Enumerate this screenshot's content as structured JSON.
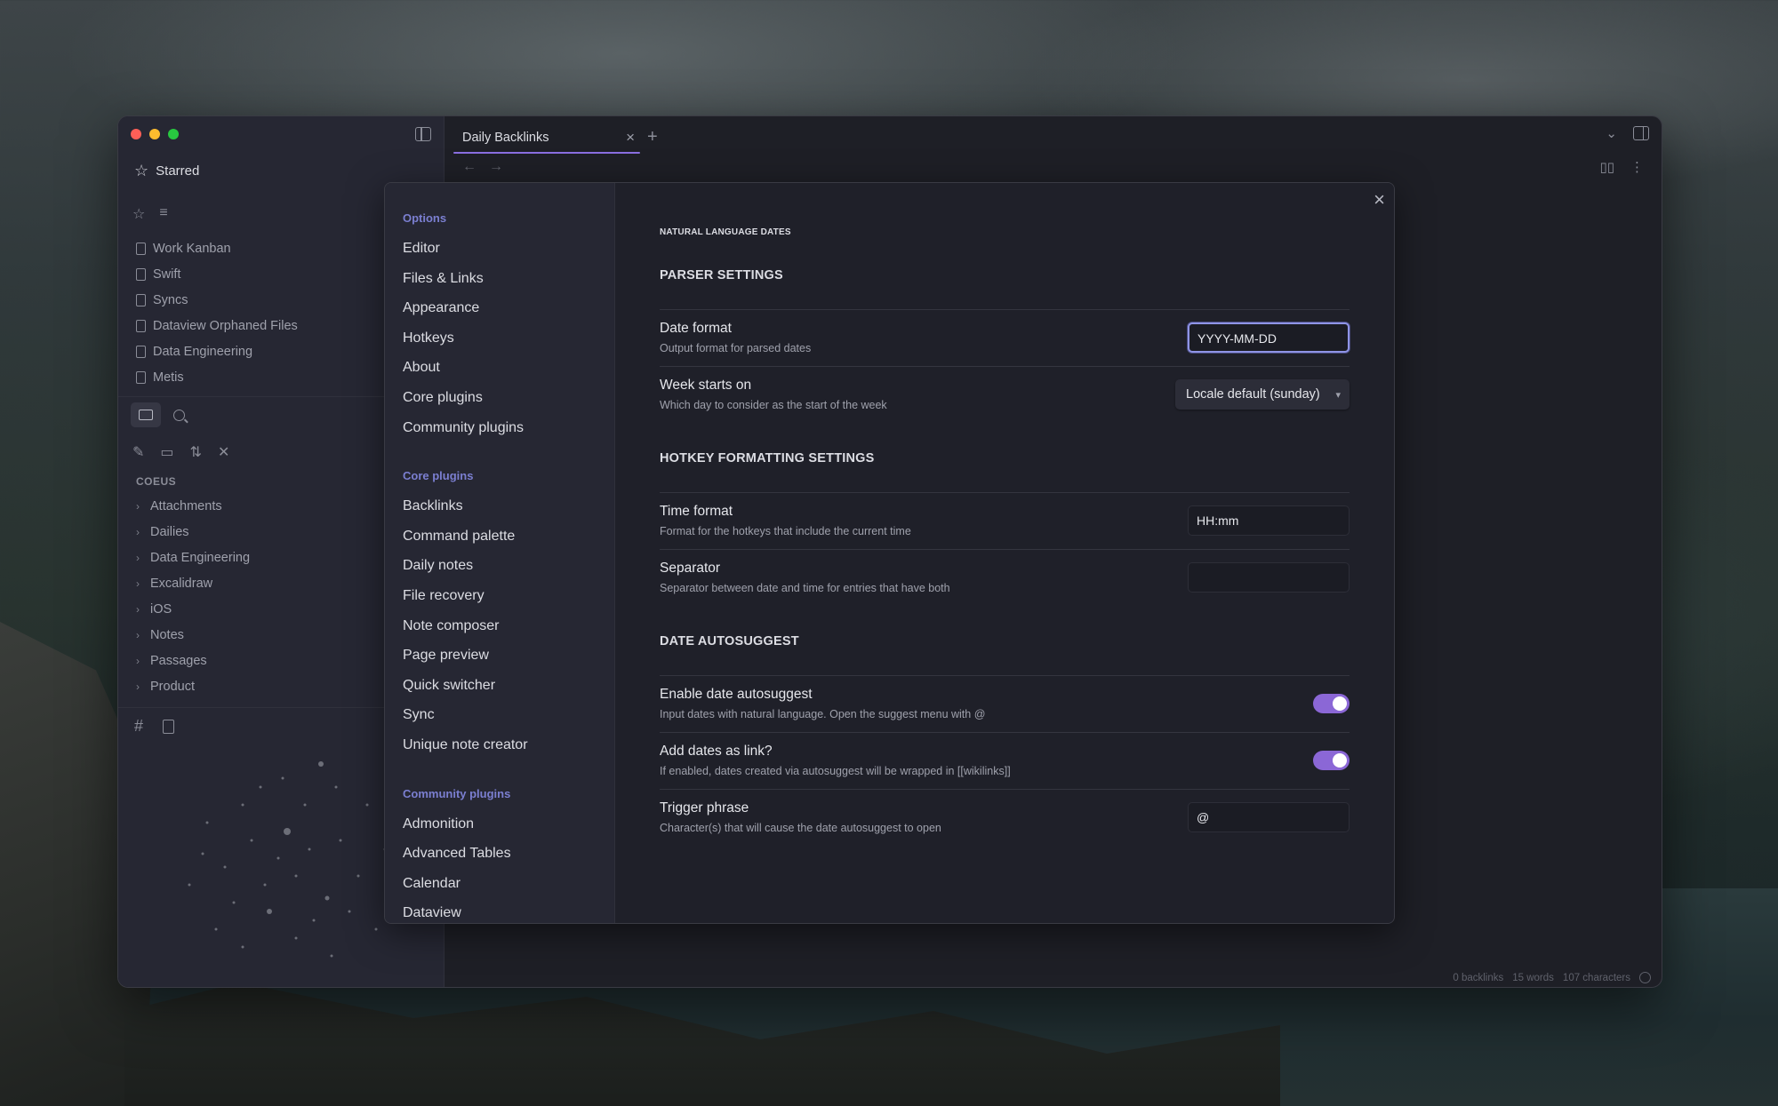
{
  "window": {
    "tab_title": "Daily Backlinks"
  },
  "sidebar": {
    "starred_label": "Starred",
    "starred_items": [
      "Work Kanban",
      "Swift",
      "Syncs",
      "Dataview Orphaned Files",
      "Data Engineering",
      "Metis"
    ],
    "vault_name": "COEUS",
    "folders": [
      "Attachments",
      "Dailies",
      "Data Engineering",
      "Excalidraw",
      "iOS",
      "Notes",
      "Passages",
      "Product"
    ]
  },
  "status": {
    "backlinks": "0 backlinks",
    "words": "15 words",
    "characters": "107 characters"
  },
  "settings_nav": {
    "options_title": "Options",
    "options": [
      "Editor",
      "Files & Links",
      "Appearance",
      "Hotkeys",
      "About",
      "Core plugins",
      "Community plugins"
    ],
    "core_title": "Core plugins",
    "core": [
      "Backlinks",
      "Command palette",
      "Daily notes",
      "File recovery",
      "Note composer",
      "Page preview",
      "Quick switcher",
      "Sync",
      "Unique note creator"
    ],
    "community_title": "Community plugins",
    "community": [
      "Admonition",
      "Advanced Tables",
      "Calendar",
      "Dataview"
    ]
  },
  "plugin": {
    "title": "NATURAL LANGUAGE DATES",
    "parser_heading": "PARSER SETTINGS",
    "date_format": {
      "name": "Date format",
      "desc": "Output format for parsed dates",
      "value": "YYYY-MM-DD"
    },
    "week_start": {
      "name": "Week starts on",
      "desc": "Which day to consider as the start of the week",
      "value": "Locale default (sunday)"
    },
    "hotkey_heading": "HOTKEY FORMATTING SETTINGS",
    "time_format": {
      "name": "Time format",
      "desc": "Format for the hotkeys that include the current time",
      "value": "HH:mm"
    },
    "separator": {
      "name": "Separator",
      "desc": "Separator between date and time for entries that have both",
      "value": ""
    },
    "autosuggest_heading": "DATE AUTOSUGGEST",
    "enable_autosuggest": {
      "name": "Enable date autosuggest",
      "desc": "Input dates with natural language. Open the suggest menu with @",
      "enabled": true
    },
    "dates_as_link": {
      "name": "Add dates as link?",
      "desc": "If enabled, dates created via autosuggest will be wrapped in [[wikilinks]]",
      "enabled": true
    },
    "trigger_phrase": {
      "name": "Trigger phrase",
      "desc": "Character(s) that will cause the date autosuggest to open",
      "value": "@"
    }
  },
  "colors": {
    "accent": "#8b67d6",
    "focus_ring": "#8f94e6",
    "section_label": "#7b7fd1"
  }
}
